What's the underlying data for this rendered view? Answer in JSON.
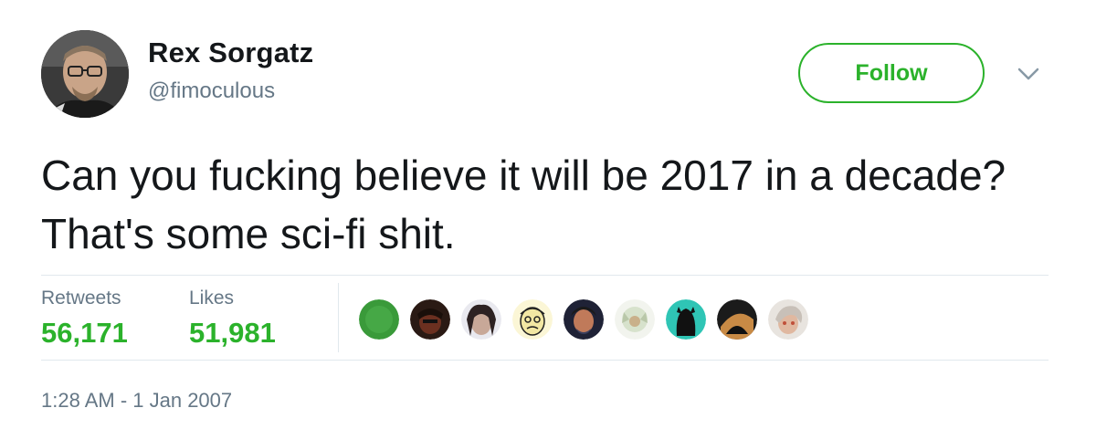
{
  "author": {
    "name": "Rex Sorgatz",
    "handle": "@fimoculous",
    "avatar_icon": "profile-photo-icon"
  },
  "follow_button": {
    "label": "Follow",
    "color": "#2bb22b"
  },
  "menu_icon": "chevron-down-icon",
  "tweet": {
    "text": "Can you fucking believe it will be 2017 in a decade? That's some sci-fi shit."
  },
  "stats": {
    "retweets_label": "Retweets",
    "retweets_value": "56,171",
    "likes_label": "Likes",
    "likes_value": "51,981"
  },
  "likers": [
    {
      "icon": "liker-avatar-icon",
      "color": "#3a9a3a"
    },
    {
      "icon": "liker-avatar-icon",
      "color": "#6b3020"
    },
    {
      "icon": "liker-avatar-icon",
      "color": "#c8a898"
    },
    {
      "icon": "liker-avatar-icon",
      "color": "#f2e7a3"
    },
    {
      "icon": "liker-avatar-icon",
      "color": "#3b3f5e"
    },
    {
      "icon": "liker-avatar-icon",
      "color": "#d7e2cc"
    },
    {
      "icon": "liker-avatar-icon",
      "color": "#2fc5b5"
    },
    {
      "icon": "liker-avatar-icon",
      "color": "#c88a45"
    },
    {
      "icon": "liker-avatar-icon",
      "color": "#c8c0b8"
    }
  ],
  "timestamp": "1:28 AM - 1 Jan 2007",
  "colors": {
    "accent": "#2bb22b",
    "text": "#14171a",
    "secondary_text": "#657786",
    "divider": "#e1e8ed"
  }
}
